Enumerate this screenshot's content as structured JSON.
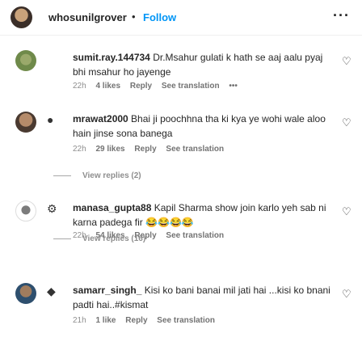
{
  "header": {
    "username": "whosunilgrover",
    "separator": "•",
    "follow_label": "Follow",
    "more_icon": "more-horizontal-icon",
    "more_glyph": "···"
  },
  "comments": [
    {
      "username": "sumit.ray.144734",
      "text": "Dr.Msahur gulati k hath se aaj aalu pyaj bhi msahur ho jayenge",
      "time": "22h",
      "likes": "4 likes",
      "reply": "Reply",
      "translation": "See translation",
      "options": "•••"
    },
    {
      "username": "mrawat2000",
      "text": "Bhai ji poochhna tha ki kya ye wohi wale aloo hain jinse sona banega",
      "time": "22h",
      "likes": "29 likes",
      "reply": "Reply",
      "translation": "See translation",
      "view_replies": "View replies (2)"
    },
    {
      "username": "manasa_gupta88",
      "text": "Kapil Sharma show join karlo yeh sab ni karna padega fir 😂😂😂😂",
      "time": "22h",
      "likes": "54 likes",
      "reply": "Reply",
      "translation": "See translation",
      "view_replies": "View replies (16)"
    },
    {
      "username": "samarr_singh_",
      "text": "Kisi ko bani banai mil jati hai ...kisi ko bnani padti hai..#kismat",
      "time": "21h",
      "likes": "1 like",
      "reply": "Reply",
      "translation": "See translation"
    }
  ],
  "heart_glyph": "♡",
  "colors": {
    "accent": "#0095f6",
    "muted": "#8e8e8e",
    "text": "#262626"
  }
}
